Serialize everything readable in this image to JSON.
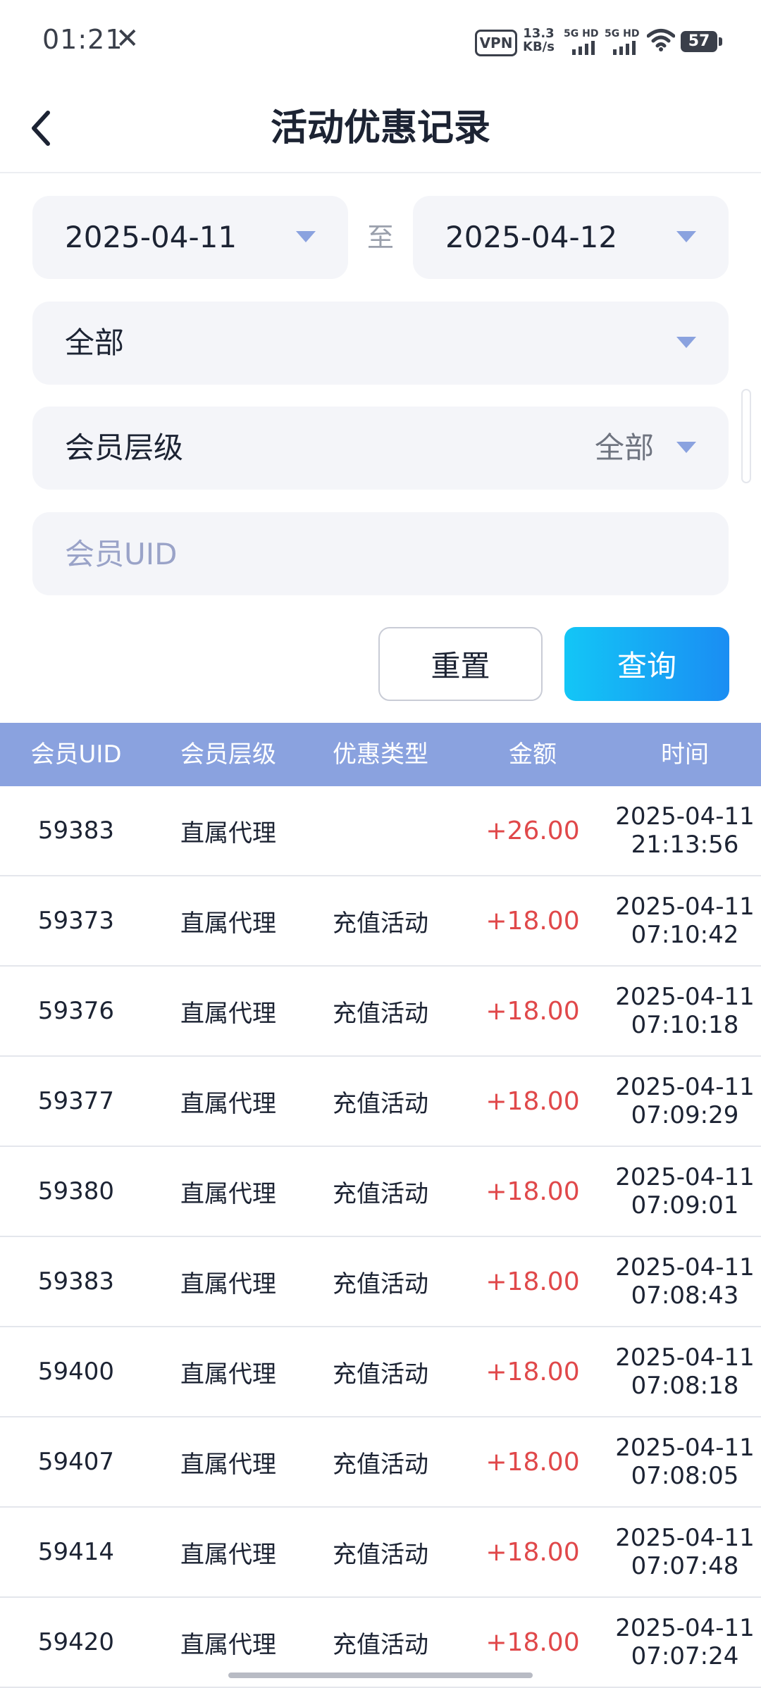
{
  "status_bar": {
    "time": "01:21",
    "notification_icon": "close-x-icon",
    "vpn_label": "VPN",
    "net_speed_value": "13.3",
    "net_speed_unit": "KB/s",
    "signal1_label": "5G HD",
    "signal2_label": "5G HD",
    "battery": "57"
  },
  "header": {
    "title": "活动优惠记录",
    "back_icon": "chevron-left-icon"
  },
  "filters": {
    "start_date": "2025-04-11",
    "to_label": "至",
    "end_date": "2025-04-12",
    "type_value": "全部",
    "level_label": "会员层级",
    "level_value": "全部",
    "uid_placeholder": "会员UID",
    "uid_value": ""
  },
  "actions": {
    "reset_label": "重置",
    "query_label": "查询"
  },
  "table": {
    "columns": [
      "会员UID",
      "会员层级",
      "优惠类型",
      "金额",
      "时间"
    ],
    "rows": [
      {
        "uid": "59383",
        "level": "直属代理",
        "type": "",
        "amount": "+26.00",
        "date": "2025-04-11",
        "time": "21:13:56"
      },
      {
        "uid": "59373",
        "level": "直属代理",
        "type": "充值活动",
        "amount": "+18.00",
        "date": "2025-04-11",
        "time": "07:10:42"
      },
      {
        "uid": "59376",
        "level": "直属代理",
        "type": "充值活动",
        "amount": "+18.00",
        "date": "2025-04-11",
        "time": "07:10:18"
      },
      {
        "uid": "59377",
        "level": "直属代理",
        "type": "充值活动",
        "amount": "+18.00",
        "date": "2025-04-11",
        "time": "07:09:29"
      },
      {
        "uid": "59380",
        "level": "直属代理",
        "type": "充值活动",
        "amount": "+18.00",
        "date": "2025-04-11",
        "time": "07:09:01"
      },
      {
        "uid": "59383",
        "level": "直属代理",
        "type": "充值活动",
        "amount": "+18.00",
        "date": "2025-04-11",
        "time": "07:08:43"
      },
      {
        "uid": "59400",
        "level": "直属代理",
        "type": "充值活动",
        "amount": "+18.00",
        "date": "2025-04-11",
        "time": "07:08:18"
      },
      {
        "uid": "59407",
        "level": "直属代理",
        "type": "充值活动",
        "amount": "+18.00",
        "date": "2025-04-11",
        "time": "07:08:05"
      },
      {
        "uid": "59414",
        "level": "直属代理",
        "type": "充值活动",
        "amount": "+18.00",
        "date": "2025-04-11",
        "time": "07:07:48"
      },
      {
        "uid": "59420",
        "level": "直属代理",
        "type": "充值活动",
        "amount": "+18.00",
        "date": "2025-04-11",
        "time": "07:07:24"
      }
    ]
  },
  "colors": {
    "table_header": "#8aa2df",
    "amount_positive": "#e0484a",
    "dropdown_arrow": "#8aa2df",
    "query_gradient_start": "#13c6f6",
    "query_gradient_end": "#1a8df3"
  }
}
